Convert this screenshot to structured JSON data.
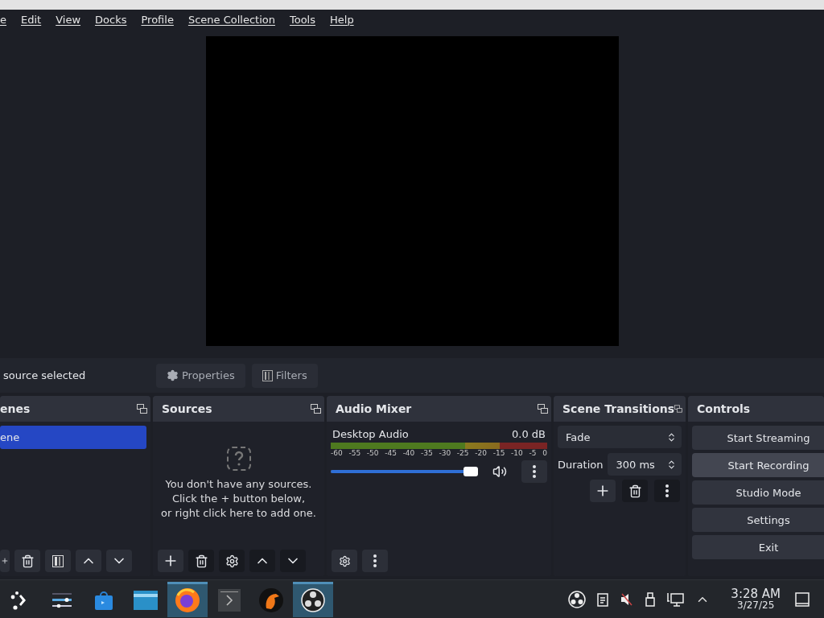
{
  "menu": [
    "e",
    "Edit",
    "View",
    "Docks",
    "Profile",
    "Scene Collection",
    "Tools",
    "Help"
  ],
  "context_bar": {
    "status": "source selected",
    "buttons": [
      {
        "kind": "properties",
        "label": "Properties"
      },
      {
        "kind": "filters",
        "label": "Filters"
      }
    ]
  },
  "scenes": {
    "title": "enes",
    "items": [
      {
        "label": "ene",
        "selected": true
      }
    ]
  },
  "sources": {
    "title": "Sources",
    "empty_lines": [
      "You don't have any sources.",
      "Click the + button below,",
      "or right click here to add one."
    ]
  },
  "audio_mixer": {
    "title": "Audio Mixer",
    "channels": [
      {
        "name": "Desktop Audio",
        "reading": "0.0 dB",
        "level": 0.95,
        "ticks": [
          "-60",
          "-55",
          "-50",
          "-45",
          "-40",
          "-35",
          "-30",
          "-25",
          "-20",
          "-15",
          "-10",
          "-5",
          "0"
        ]
      }
    ]
  },
  "scene_transitions": {
    "title": "Scene Transitions",
    "transition": "Fade",
    "duration_label": "Duration",
    "duration": "300 ms"
  },
  "controls": {
    "title": "Controls",
    "buttons": [
      {
        "label": "Start Streaming",
        "hovered": false
      },
      {
        "label": "Start Recording",
        "hovered": true
      },
      {
        "label": "Studio Mode",
        "hovered": false
      },
      {
        "label": "Settings",
        "hovered": false
      },
      {
        "label": "Exit",
        "hovered": false
      }
    ]
  },
  "taskbar": {
    "items": [
      {
        "kind": "launcher",
        "active": false
      },
      {
        "kind": "settings",
        "active": false
      },
      {
        "kind": "store",
        "active": false
      },
      {
        "kind": "files",
        "active": false
      },
      {
        "kind": "browser",
        "active": true
      },
      {
        "kind": "terminal",
        "active": false
      },
      {
        "kind": "bird",
        "active": false
      },
      {
        "kind": "obs",
        "active": true
      }
    ],
    "time": "3:28 AM",
    "date": "3/27/25"
  }
}
